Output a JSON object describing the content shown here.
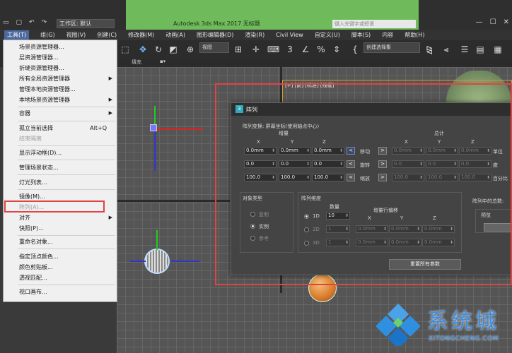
{
  "titlebar": {
    "workspace": "工作区: 默认",
    "app_title": "Autodesk 3ds Max 2017    无标题",
    "search_placeholder": "键入关键字或短语",
    "minimize": "—",
    "restore": "☐",
    "close": "✕"
  },
  "menubar": [
    "工具(T)",
    "组(G)",
    "视图(V)",
    "创建(C)",
    "修改器(M)",
    "动画(A)",
    "图形编辑器(D)",
    "渲染(R)",
    "Civil View",
    "自定义(U)",
    "脚本(S)",
    "内容",
    "帮助(H)"
  ],
  "toolbar": {
    "view_select": "视图",
    "selection_set": "创建选择集",
    "sub_label": "填充"
  },
  "viewport": {
    "label": "[+] [前] [标准] [线框]"
  },
  "tools_menu": [
    {
      "label": "场景资源管理器..."
    },
    {
      "label": "层资源管理器..."
    },
    {
      "label": "折缝资源管理器..."
    },
    {
      "label": "所有全局资源管理器",
      "submenu": true
    },
    {
      "label": "管理本地资源管理器..."
    },
    {
      "label": "本地场景资源管理器",
      "submenu": true
    },
    {
      "label": "容器",
      "submenu": true
    },
    {
      "label": "孤立当前选择",
      "shortcut": "Alt+Q"
    },
    {
      "label": "结束隔离",
      "disabled": true
    },
    {
      "label": "显示浮动框(D)..."
    },
    {
      "label": "管理场景状态..."
    },
    {
      "label": "灯光列表..."
    },
    {
      "label": "镜像(M)..."
    },
    {
      "label": "阵列(A)...",
      "disabled": true
    },
    {
      "label": "对齐",
      "submenu": true
    },
    {
      "label": "快照(P)..."
    },
    {
      "label": "重命名对象..."
    },
    {
      "label": "指定顶点颜色..."
    },
    {
      "label": "颜色剪贴板..."
    },
    {
      "label": "透视匹配..."
    },
    {
      "label": "视口画布..."
    }
  ],
  "dialog": {
    "title": "阵列",
    "transform_label": "阵列变换: 屏幕坐标(使用轴点中心)",
    "incremental": "增量",
    "totals": "总计",
    "x": "X",
    "y": "Y",
    "z": "Z",
    "move": "移动",
    "rotate": "旋转",
    "scale": "缩放",
    "units": "单位",
    "degrees": "度",
    "percent": "百分比",
    "arrow_left": "<",
    "arrow_right": ">",
    "move_vals": [
      "0.0mm",
      "0.0mm",
      "0.0mm"
    ],
    "rotate_vals": [
      "0.0",
      "0.0",
      "0.0"
    ],
    "scale_vals": [
      "100.0",
      "100.0",
      "100.0"
    ],
    "move_totals": [
      "0.0mm",
      "0.0mm",
      "0.0mm"
    ],
    "rotate_totals": [
      "0.0",
      "0.0",
      "0.0"
    ],
    "scale_totals": [
      "100.0",
      "100.0",
      "100.0"
    ],
    "object_type": "对象类型",
    "copy": "复制",
    "instance": "实例",
    "reference": "参考",
    "array_dims": "阵列维度",
    "count": "数量",
    "incr_row_offset": "增量行偏移",
    "dim_1d": "1D",
    "dim_2d": "2D",
    "dim_3d": "3D",
    "count_1d": "10",
    "count_2d": "1",
    "count_3d": "1",
    "offset_2d": [
      "0.0mm",
      "0.0mm",
      "0.0mm"
    ],
    "offset_3d": [
      "0.0mm",
      "0.0mm",
      "0.0mm"
    ],
    "total_in_array": "阵列中的总数:",
    "preview": "预览",
    "reset_all": "重置所有参数"
  },
  "watermark": {
    "text": "系统城",
    "url": "XITONGCHENG.COM"
  },
  "colors": {
    "title_green": "#6fba5a",
    "highlight_red": "#e04444",
    "watermark_blue": "#3d8de0"
  }
}
